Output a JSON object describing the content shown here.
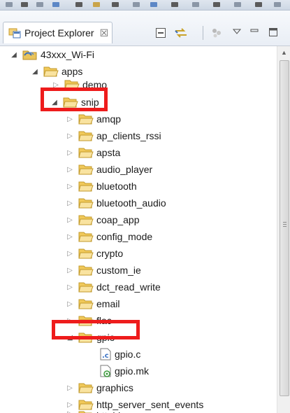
{
  "view": {
    "tab_title": "Project Explorer",
    "close_glyph": "☒",
    "icons": [
      "project-explorer-icon",
      "collapse-all-icon",
      "link-with-editor-icon",
      "focus-on-active-task-icon",
      "view-menu-icon",
      "minimize-icon",
      "maximize-icon"
    ]
  },
  "tree": {
    "project": "43xxx_Wi-Fi",
    "apps": "apps",
    "demo": "demo",
    "snip": "snip",
    "snip_children": [
      "amqp",
      "ap_clients_rssi",
      "apsta",
      "audio_player",
      "bluetooth",
      "bluetooth_audio",
      "coap_app",
      "config_mode",
      "crypto",
      "custom_ie",
      "dct_read_write",
      "email",
      "flac"
    ],
    "gpio": "gpio",
    "gpio_files": [
      "gpio.c",
      "gpio.mk"
    ],
    "after_gpio": [
      "graphics",
      "http_server_sent_events",
      "httpbin_org"
    ]
  },
  "colors": {
    "highlight": "#ee1c1c",
    "folder": "#f1c95a",
    "c_file": "#3b73c5"
  }
}
